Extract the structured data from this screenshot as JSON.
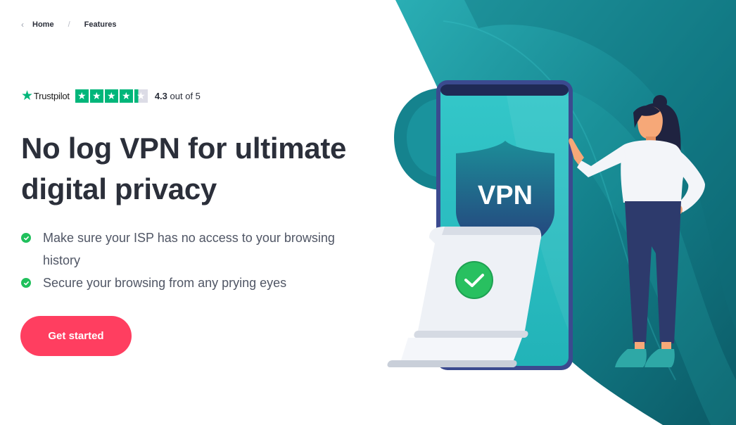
{
  "breadcrumb": {
    "items": [
      "Home",
      "Features"
    ],
    "separator": "/"
  },
  "trustpilot": {
    "brand": "Trustpilot",
    "rating": "4.3",
    "rating_suffix": "out of 5",
    "stars_filled": 4.3,
    "stars_total": 5
  },
  "hero": {
    "headline": "No log VPN for ultimate digital privacy",
    "features": [
      "Make sure your ISP has no access to your browsing history",
      "Secure your browsing from any prying eyes"
    ],
    "cta_label": "Get started"
  },
  "illustration": {
    "shield_text": "VPN"
  },
  "colors": {
    "accent": "#ff3e60",
    "teal": "#1a8b94",
    "check": "#20c05c",
    "trustpilot": "#00b67a"
  }
}
